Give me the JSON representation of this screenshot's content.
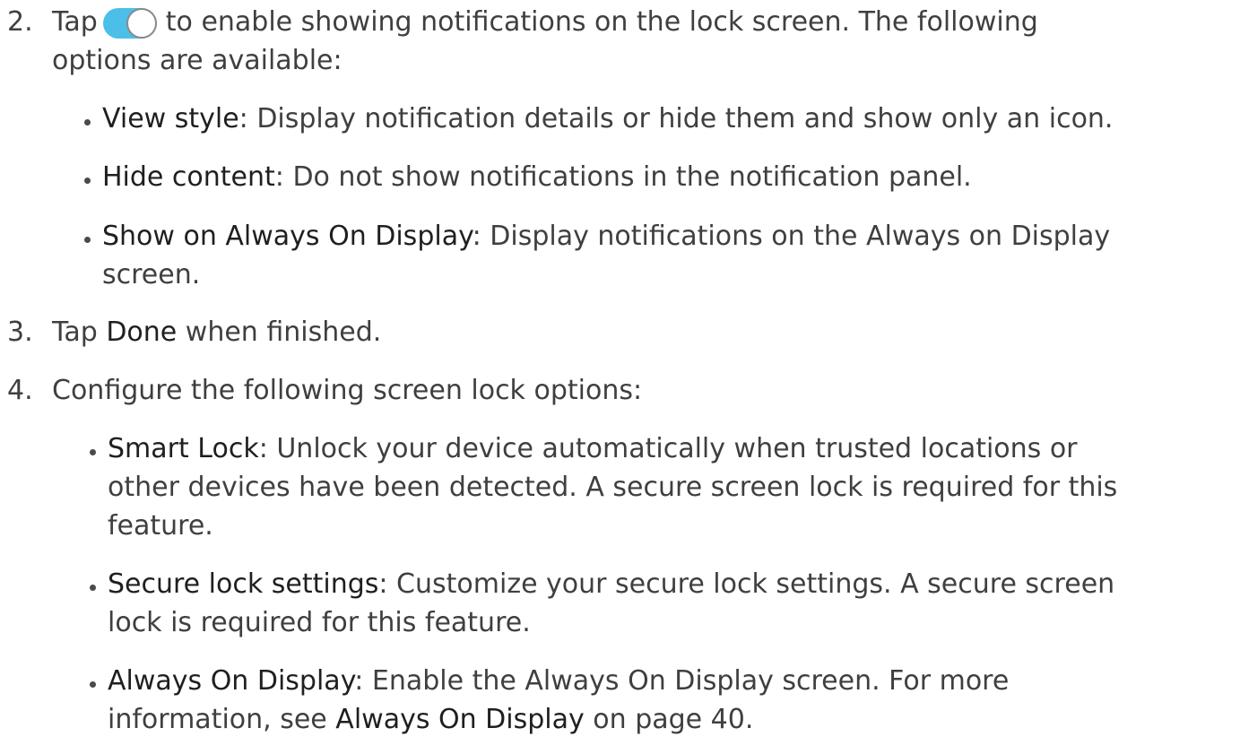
{
  "steps": [
    {
      "number": "2.",
      "text_before_icon": "Tap",
      "icon": "toggle-switch-icon",
      "text_after_icon": "to enable showing notifications on the lock screen. The following",
      "line2": "options are available:",
      "bullets": [
        {
          "term": "View style",
          "desc": ": Display notification details or hide them and show only an icon."
        },
        {
          "term": "Hide content",
          "desc": ": Do not show notifications in the notification panel."
        },
        {
          "term": "Show on Always On Display",
          "desc": ": Display notifications on the Always on Display",
          "desc2": "screen."
        }
      ]
    },
    {
      "number": "3.",
      "pre": "Tap ",
      "term": "Done",
      "post": " when finished."
    },
    {
      "number": "4.",
      "text": "Configure the following screen lock options:",
      "bullets": [
        {
          "term": "Smart Lock",
          "desc": ": Unlock your device automatically when trusted locations or",
          "desc2": "other devices have been detected. A secure screen lock is required for this",
          "desc3": "feature."
        },
        {
          "term": "Secure lock settings",
          "desc": ": Customize your secure lock settings. A secure screen",
          "desc2": "lock is required for this feature."
        },
        {
          "term": "Always On Display",
          "desc": ": Enable the Always On Display screen. For more",
          "desc2_pre": "information, see ",
          "desc2_link": "Always On Display",
          "desc2_post": " on page 40."
        }
      ]
    }
  ],
  "colors": {
    "toggle_track": "#4bbfe8",
    "text": "#3f3f3f",
    "term": "#1f1f1f"
  }
}
